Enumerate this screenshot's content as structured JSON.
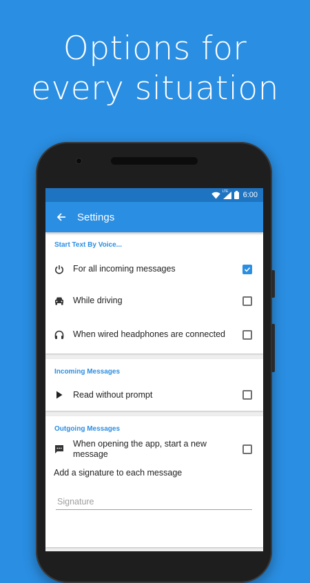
{
  "promo": {
    "line1": "Options for",
    "line2": "every situation"
  },
  "statusbar": {
    "time": "6:00",
    "network": "LTE",
    "icons": [
      "wifi-icon",
      "cell-signal-icon",
      "battery-icon"
    ]
  },
  "appbar": {
    "title": "Settings",
    "back_icon": "arrow-left-icon"
  },
  "sections": {
    "start": {
      "header": "Start Text By Voice...",
      "items": [
        {
          "label": "For all incoming messages",
          "icon": "power-icon",
          "checked": true
        },
        {
          "label": "While driving",
          "icon": "car-icon",
          "checked": false
        },
        {
          "label": "When wired headphones are connected",
          "icon": "headphones-icon",
          "checked": false
        }
      ]
    },
    "incoming": {
      "header": "Incoming Messages",
      "items": [
        {
          "label": "Read without prompt",
          "icon": "play-icon",
          "checked": false
        }
      ]
    },
    "outgoing": {
      "header": "Outgoing Messages",
      "items": [
        {
          "label": "When opening the app, start a new message",
          "icon": "message-icon",
          "checked": false
        }
      ],
      "signature_label": "Add a signature to each message",
      "signature_placeholder": "Signature"
    }
  },
  "colors": {
    "accent": "#2a8ee2",
    "status_bar": "#1f74c2",
    "phone_body": "#1e1e1e"
  }
}
